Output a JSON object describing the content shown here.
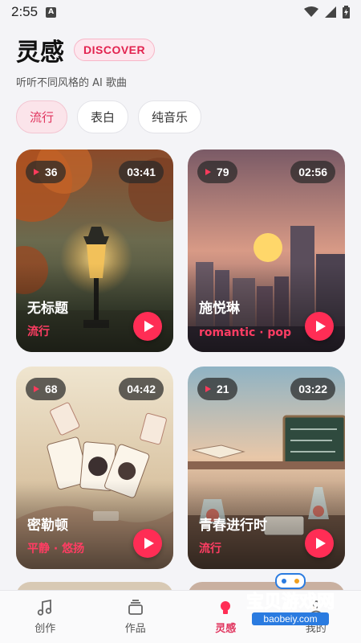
{
  "status_bar": {
    "time": "2:55",
    "notification_letter": "A"
  },
  "header": {
    "title": "灵感",
    "badge": "DISCOVER",
    "subtitle": "听听不同风格的 AI 歌曲"
  },
  "filters": [
    {
      "label": "流行",
      "active": true
    },
    {
      "label": "表白",
      "active": false
    },
    {
      "label": "纯音乐",
      "active": false
    }
  ],
  "songs": [
    {
      "title": "无标题",
      "tag": "流行",
      "plays": "36",
      "duration": "03:41"
    },
    {
      "title": "施悦琳",
      "tag": "romantic · pop",
      "plays": "79",
      "duration": "02:56"
    },
    {
      "title": "密勒顿",
      "tag": "平静 · 悠扬",
      "plays": "68",
      "duration": "04:42"
    },
    {
      "title": "青春进行时",
      "tag": "流行",
      "plays": "21",
      "duration": "03:22"
    }
  ],
  "tabbar": [
    {
      "label": "创作",
      "icon": "music-note-icon"
    },
    {
      "label": "作品",
      "icon": "stack-icon"
    },
    {
      "label": "灵感",
      "icon": "lightbulb-icon"
    },
    {
      "label": "我的",
      "icon": "person-icon"
    }
  ],
  "watermark": {
    "line1": "宝贝游戏网",
    "line2": "baobeiy.com"
  },
  "colors": {
    "accent": "#ff2d55",
    "accent_text": "#e0325c",
    "badge_bg": "#fde7ee"
  }
}
